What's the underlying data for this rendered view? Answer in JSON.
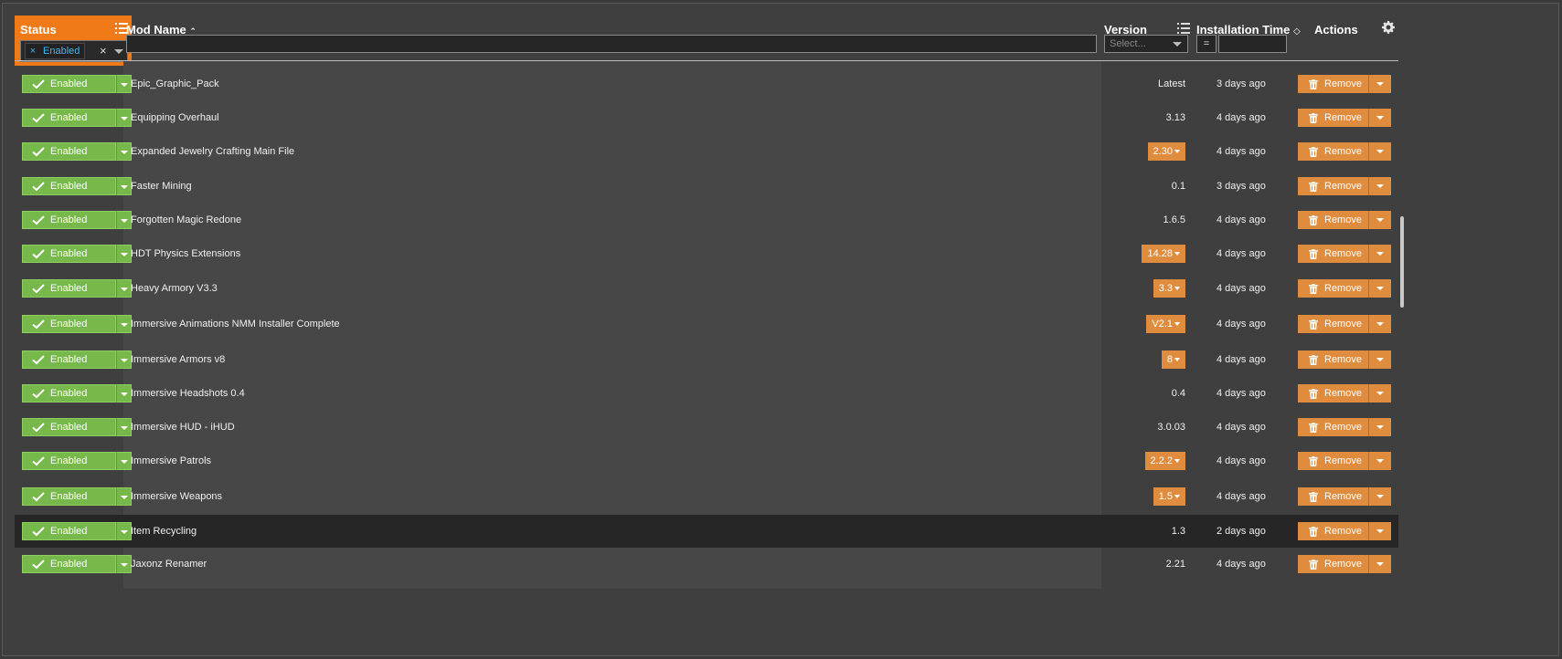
{
  "header": {
    "status_label": "Status",
    "status_filter_chip": "Enabled",
    "chip_remove_glyph": "×",
    "clear_glyph": "×",
    "mod_name_label": "Mod Name",
    "mod_name_sort_glyph": "⌃",
    "version_label": "Version",
    "version_placeholder": "Select...",
    "install_time_label": "Installation Time",
    "install_time_sort_glyph": "◇",
    "install_time_operator": "=",
    "actions_label": "Actions",
    "icons": [
      "list-icon",
      "gear-icon",
      "chevron-down-icon"
    ]
  },
  "rows": [
    {
      "status": "Enabled",
      "name": "Epic_Graphic_Pack",
      "version": "Latest",
      "version_dropdown": false,
      "time": "3 days ago",
      "action": "Remove"
    },
    {
      "status": "Enabled",
      "name": "Equipping Overhaul",
      "version": "3.13",
      "version_dropdown": false,
      "time": "4 days ago",
      "action": "Remove"
    },
    {
      "status": "Enabled",
      "name": "Expanded Jewelry Crafting Main File",
      "version": "2.30",
      "version_dropdown": true,
      "time": "4 days ago",
      "action": "Remove"
    },
    {
      "status": "Enabled",
      "name": "Faster Mining",
      "version": "0.1",
      "version_dropdown": false,
      "time": "3 days ago",
      "action": "Remove"
    },
    {
      "status": "Enabled",
      "name": "Forgotten Magic Redone",
      "version": "1.6.5",
      "version_dropdown": false,
      "time": "4 days ago",
      "action": "Remove"
    },
    {
      "status": "Enabled",
      "name": "HDT Physics Extensions",
      "version": "14.28",
      "version_dropdown": true,
      "time": "4 days ago",
      "action": "Remove"
    },
    {
      "status": "Enabled",
      "name": "Heavy Armory V3.3",
      "version": "3.3",
      "version_dropdown": true,
      "time": "4 days ago",
      "action": "Remove"
    },
    {
      "status": "Enabled",
      "name": "Immersive Animations NMM Installer Complete",
      "version": "V2.1",
      "version_dropdown": true,
      "time": "4 days ago",
      "action": "Remove"
    },
    {
      "status": "Enabled",
      "name": "Immersive Armors v8",
      "version": "8",
      "version_dropdown": true,
      "time": "4 days ago",
      "action": "Remove"
    },
    {
      "status": "Enabled",
      "name": "Immersive Headshots 0.4",
      "version": "0.4",
      "version_dropdown": false,
      "time": "4 days ago",
      "action": "Remove"
    },
    {
      "status": "Enabled",
      "name": "Immersive HUD - iHUD",
      "version": "3.0.03",
      "version_dropdown": false,
      "time": "4 days ago",
      "action": "Remove"
    },
    {
      "status": "Enabled",
      "name": "Immersive Patrols",
      "version": "2.2.2",
      "version_dropdown": true,
      "time": "4 days ago",
      "action": "Remove"
    },
    {
      "status": "Enabled",
      "name": "Immersive Weapons",
      "version": "1.5",
      "version_dropdown": true,
      "time": "4 days ago",
      "action": "Remove"
    },
    {
      "status": "Enabled",
      "name": "Item Recycling",
      "version": "1.3",
      "version_dropdown": false,
      "time": "2 days ago",
      "action": "Remove",
      "selected": true
    },
    {
      "status": "Enabled",
      "name": "Jaxonz Renamer",
      "version": "2.21",
      "version_dropdown": false,
      "time": "4 days ago",
      "action": "Remove"
    }
  ],
  "colors": {
    "status_header": "#f07a17",
    "enabled_green": "#77b84a",
    "action_orange": "#e08c3f",
    "chip_text": "#3fb6ee"
  }
}
